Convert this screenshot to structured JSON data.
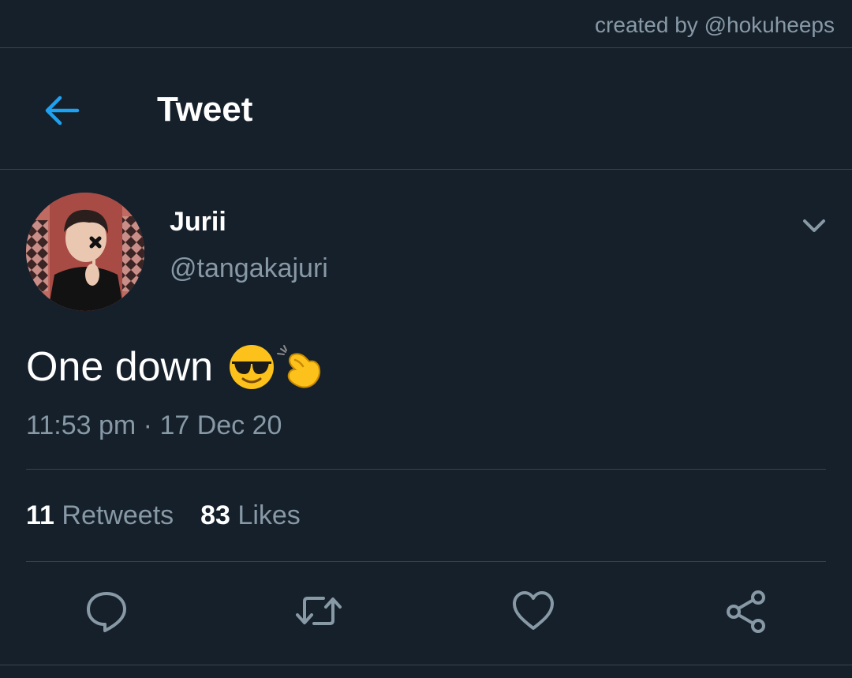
{
  "watermark": "created by @hokuheeps",
  "header": {
    "title": "Tweet"
  },
  "tweet": {
    "display_name": "Jurii",
    "handle": "@tangakajuri",
    "text": "One down",
    "emojis": [
      "smiling-face-with-sunglasses",
      "pinching-hand"
    ],
    "timestamp": "11:53 pm · 17 Dec 20",
    "retweets_count": "11",
    "retweets_label": "Retweets",
    "likes_count": "83",
    "likes_label": "Likes"
  },
  "colors": {
    "background": "#15202b",
    "divider": "#38444d",
    "accent": "#1da1f2",
    "secondary_text": "#8899a6"
  },
  "icons": {
    "back": "arrow-left-icon",
    "more": "chevron-down-icon",
    "reply": "reply-icon",
    "retweet": "retweet-icon",
    "like": "heart-icon",
    "share": "share-icon"
  }
}
